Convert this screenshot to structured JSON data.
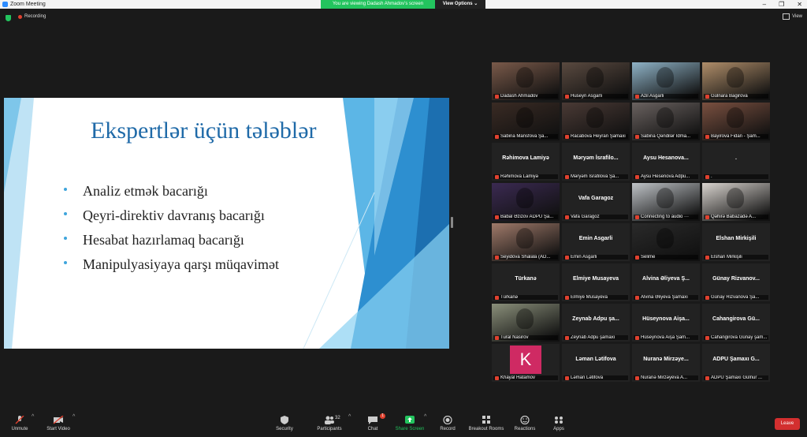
{
  "window": {
    "title": "Zoom Meeting"
  },
  "banner": {
    "message": "You are viewing Dadash Ahmadov’s screen",
    "options": "View Options ⌄"
  },
  "recording": {
    "label": "Recording"
  },
  "view": {
    "label": "View"
  },
  "slide": {
    "title": "Ekspertlər üçün tələblər",
    "bullets": [
      "Analiz etmək bacarığı",
      "Qeyri-direktiv davranış bacarığı",
      "Hesabat hazırlamaq bacarığı",
      "Manipulyasiyaya qarşı müqavimət"
    ]
  },
  "participants": [
    {
      "name": "Dadash Ahmadov",
      "center": "",
      "kind": "video",
      "color": "#7a5a4a"
    },
    {
      "name": "Huseyn Asgarli",
      "center": "",
      "kind": "video",
      "color": "#5a4a40"
    },
    {
      "name": "Azil Asgarli",
      "center": "",
      "kind": "video",
      "color": "#8fb3c7",
      "active": true
    },
    {
      "name": "Gülnara Bagirova",
      "center": "",
      "kind": "video",
      "color": "#b08e6a"
    },
    {
      "name": "Sabina Mansfova Şa...",
      "center": "",
      "kind": "video",
      "color": "#3a2b24"
    },
    {
      "name": "Racabova Heyran Şamaxi",
      "center": "",
      "kind": "video",
      "color": "#4a3a35"
    },
    {
      "name": "Sabina Qəndilər İdma...",
      "center": "",
      "kind": "video",
      "color": "#6a6260"
    },
    {
      "name": "Bayirova Fidan - Şam...",
      "center": "",
      "kind": "video",
      "color": "#7a5040"
    },
    {
      "name": "Rəhimova Lamiyə",
      "center": "Rəhimova Lamiyə",
      "kind": "name"
    },
    {
      "name": "Məryəm İsrafilova Şa...",
      "center": "Məryəm İsrafilo...",
      "kind": "name"
    },
    {
      "name": "Aysu Hesenova Adpu...",
      "center": "Aysu Hesanova...",
      "kind": "name"
    },
    {
      "name": ".",
      "center": ".",
      "kind": "name"
    },
    {
      "name": "Babal Əzizov ADPU Şa...",
      "center": "",
      "kind": "video",
      "color": "#3b2a52"
    },
    {
      "name": "Vafa Garagoz",
      "center": "Vafa Garagoz",
      "kind": "name"
    },
    {
      "name": "Connecting to audio ···",
      "center": "",
      "kind": "video",
      "color": "#bfc3c7"
    },
    {
      "name": "Qəhirə Babazadə A...",
      "center": "",
      "kind": "video",
      "color": "#d9d4cf"
    },
    {
      "name": "Seyidova Shalala (AD...",
      "center": "",
      "kind": "video",
      "color": "#a07a6a"
    },
    {
      "name": "Emin Asgarli",
      "center": "Emin Asgarli",
      "kind": "name"
    },
    {
      "name": "Selime",
      "center": "",
      "kind": "video",
      "color": "#2a2a2a"
    },
    {
      "name": "Elshan Mirkişili",
      "center": "Elshan Mirkişili",
      "kind": "name"
    },
    {
      "name": "Türkanə",
      "center": "Türkanə",
      "kind": "name"
    },
    {
      "name": "Elmiye Musayeva",
      "center": "Elmiye Musayeva",
      "kind": "name"
    },
    {
      "name": "Alvina Əliyeva Şamaxı",
      "center": "Alvina Əliyeva Ş...",
      "kind": "name"
    },
    {
      "name": "Günay Rizvanova Şa...",
      "center": "Günay Rizvanov...",
      "kind": "name"
    },
    {
      "name": "Tural Nasirov",
      "center": "",
      "kind": "video",
      "color": "#8a8f7a"
    },
    {
      "name": "Zeynab Adpu şamaxı",
      "center": "Zeynab Adpu şa...",
      "kind": "name"
    },
    {
      "name": "Hüseynova Aişa Şam...",
      "center": "Hüseynova Aişa...",
      "kind": "name"
    },
    {
      "name": "Cahangirova Günay şam...",
      "center": "Cahangirova Gü...",
      "kind": "name"
    },
    {
      "name": "Khayal Hatamov",
      "center": "",
      "kind": "avatar",
      "letter": "K"
    },
    {
      "name": "Ləman Lətifova",
      "center": "Ləman Lətifova",
      "kind": "name"
    },
    {
      "name": "Nuranə Mirzəyeva A...",
      "center": "Nuranə Mirzəye...",
      "kind": "name"
    },
    {
      "name": "ADPU Şamaxı Gülnur ...",
      "center": "ADPU Şamaxı G...",
      "kind": "name"
    }
  ],
  "toolbar": {
    "unmute": "Unmute",
    "start_video": "Start Video",
    "security": "Security",
    "participants": "Participants",
    "participants_count": "32",
    "chat": "Chat",
    "chat_badge": "1",
    "share": "Share Screen",
    "record": "Record",
    "breakout": "Breakout Rooms",
    "reactions": "Reactions",
    "apps": "Apps",
    "leave": "Leave"
  },
  "colors": {
    "accent_green": "#23c45e",
    "leave_red": "#d32f2f",
    "slide_title": "#1f6aa8"
  }
}
